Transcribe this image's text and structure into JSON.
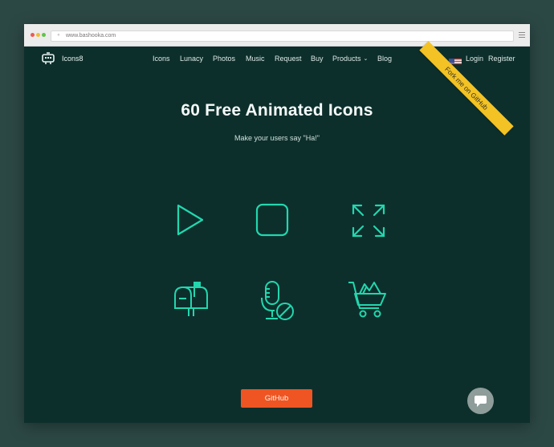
{
  "browser": {
    "url": "www.bashooka.com",
    "traffic_light_colors": {
      "close": "#ee5a52",
      "minimize": "#f0be36",
      "zoom": "#5fc548"
    }
  },
  "nav": {
    "brand": "Icons8",
    "links": [
      "Icons",
      "Lunacy",
      "Photos",
      "Music",
      "Request",
      "Buy",
      "Products",
      "Blog"
    ],
    "login": "Login",
    "register": "Register"
  },
  "ribbon": {
    "label": "Fork me on GitHub",
    "color": "#f3c224"
  },
  "hero": {
    "title": "60 Free Animated Icons",
    "subtitle": "Make your users say \"Ha!\""
  },
  "icons": [
    {
      "name": "play-icon"
    },
    {
      "name": "stop-icon"
    },
    {
      "name": "expand-icon"
    },
    {
      "name": "mailbox-icon"
    },
    {
      "name": "microphone-off-icon"
    },
    {
      "name": "shopping-cart-icon"
    }
  ],
  "cta": {
    "label": "GitHub",
    "color": "#ee5522"
  },
  "colors": {
    "accent": "#22d7ae",
    "background": "#0d2f2c",
    "outer": "#2c4845"
  }
}
